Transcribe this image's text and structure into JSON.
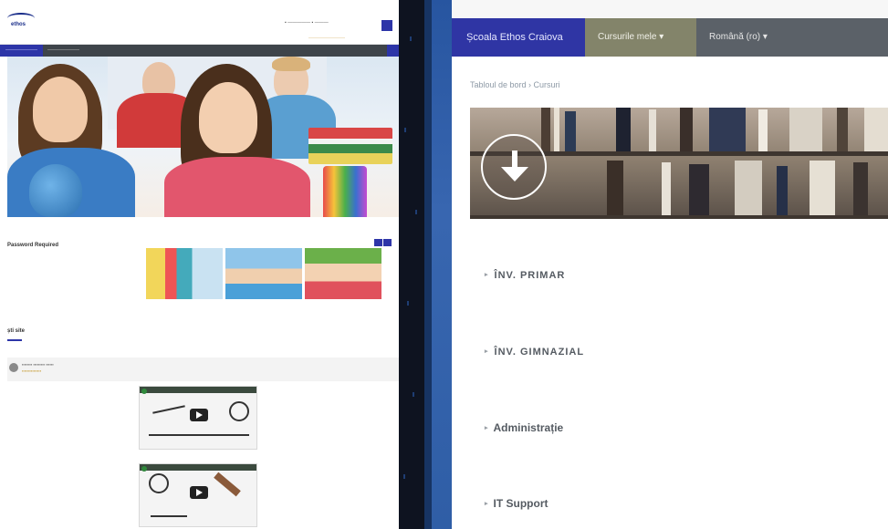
{
  "right": {
    "brand": "Școala Ethos Craiova",
    "nav_menu": [
      "Cursurile mele ▾",
      "Română (ro) ▾"
    ],
    "breadcrumb": "Tabloul de bord  ›  Cursuri",
    "categories": [
      "ÎNV. PRIMAR",
      "ÎNV. GIMNAZIAL",
      "Administrație",
      "IT Support"
    ]
  },
  "left": {
    "logo_text": "ethos",
    "section_title": "Password Required",
    "site_news_title": "ști site"
  },
  "colors": {
    "brand_blue": "#2f35a4",
    "nav_gray": "#5b6168",
    "nav_olive": "#83846a",
    "category_text": "#555b62"
  },
  "icons": [
    "download-arrow-icon",
    "search-icon",
    "play-icon",
    "triangle-right-icon"
  ]
}
